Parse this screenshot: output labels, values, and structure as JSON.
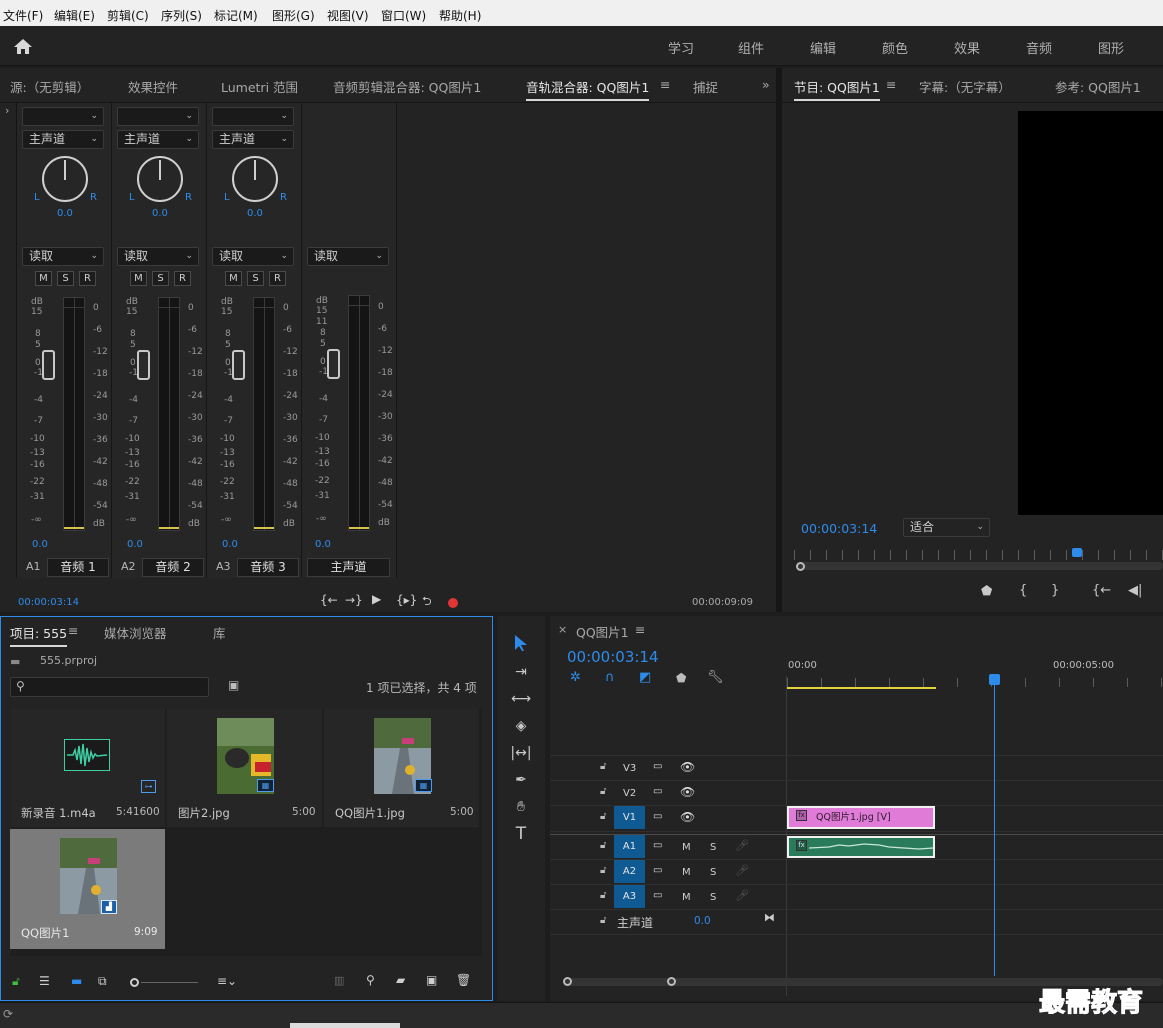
{
  "menu": [
    "文件(F)",
    "编辑(E)",
    "剪辑(C)",
    "序列(S)",
    "标记(M)",
    "图形(G)",
    "视图(V)",
    "窗口(W)",
    "帮助(H)"
  ],
  "workspaces": [
    "学习",
    "组件",
    "编辑",
    "颜色",
    "效果",
    "音频",
    "图形"
  ],
  "source_panel": {
    "tabs": [
      "源:（无剪辑）",
      "效果控件",
      "Lumetri 范围",
      "音频剪辑混合器: QQ图片1",
      "音轨混合器: QQ图片1",
      "捕捉"
    ],
    "tab_menu_glyph": "≡",
    "overflow_glyph": "»"
  },
  "mixer": {
    "strips": [
      {
        "input": "",
        "output": "主声道",
        "pan_l": "L",
        "pan_r": "R",
        "pan_value": "0.0",
        "mode": "读取",
        "m": "M",
        "s": "S",
        "r": "R",
        "volume": "0.0",
        "id": "A1",
        "name": "音频 1"
      },
      {
        "input": "",
        "output": "主声道",
        "pan_l": "L",
        "pan_r": "R",
        "pan_value": "0.0",
        "mode": "读取",
        "m": "M",
        "s": "S",
        "r": "R",
        "volume": "0.0",
        "id": "A2",
        "name": "音频 2"
      },
      {
        "input": "",
        "output": "主声道",
        "pan_l": "L",
        "pan_r": "R",
        "pan_value": "0.0",
        "mode": "读取",
        "m": "M",
        "s": "S",
        "r": "R",
        "volume": "0.0",
        "id": "A3",
        "name": "音频 3"
      }
    ],
    "master": {
      "mode": "读取",
      "volume": "0.0",
      "name": "主声道"
    },
    "left_scale": [
      "dB",
      "15",
      "8",
      "5",
      "0",
      "-1",
      "-4",
      "-7",
      "-10",
      "-13",
      "-16",
      "-22",
      "-31",
      "-∞"
    ],
    "master_left_scale": [
      "dB",
      "15",
      "11",
      "8",
      "5",
      "0",
      "-1",
      "-4",
      "-7",
      "-10",
      "-13",
      "-16",
      "-22",
      "-31",
      "-∞"
    ],
    "right_scale": [
      "0",
      "-6",
      "-12",
      "-18",
      "-24",
      "-30",
      "-36",
      "-42",
      "-48",
      "-54",
      "dB"
    ],
    "current_time": "00:00:03:14",
    "duration": "00:00:09:09"
  },
  "program": {
    "tabs": [
      "节目: QQ图片1",
      "字幕:（无字幕）",
      "参考: QQ图片1"
    ],
    "tab_menu_glyph": "≡",
    "timecode": "00:00:03:14",
    "fit": "适合"
  },
  "project": {
    "tabs": [
      "项目: 555",
      "媒体浏览器",
      "库"
    ],
    "tab_menu_glyph": "≡",
    "file": "555.prproj",
    "search_placeholder": "",
    "selection": "1 项已选择，共 4 项",
    "items": [
      {
        "name": "新录音 1.m4a",
        "duration": "5:41600"
      },
      {
        "name": "图片2.jpg",
        "duration": "5:00"
      },
      {
        "name": "QQ图片1.jpg",
        "duration": "5:00"
      },
      {
        "name": "QQ图片1",
        "duration": "9:09"
      }
    ]
  },
  "timeline": {
    "title": "QQ图片1",
    "tab_menu_glyph": "≡",
    "close_glyph": "×",
    "timecode": "00:00:03:14",
    "ruler": [
      "00:00",
      "00:00:05:00"
    ],
    "tracks_video": [
      "V3",
      "V2",
      "V1"
    ],
    "tracks_audio": [
      "A1",
      "A2",
      "A3"
    ],
    "m": "M",
    "s": "S",
    "master": "主声道",
    "master_value": "0.0",
    "clip_video": "QQ图片1.jpg [V]",
    "playhead_fraction": 0.6
  },
  "watermark": "最需教育",
  "colors": {
    "accent": "#2d8ceb",
    "clip_video": "#e07bd8",
    "clip_audio": "#2a7a5c",
    "track_target": "#0f5a93"
  }
}
